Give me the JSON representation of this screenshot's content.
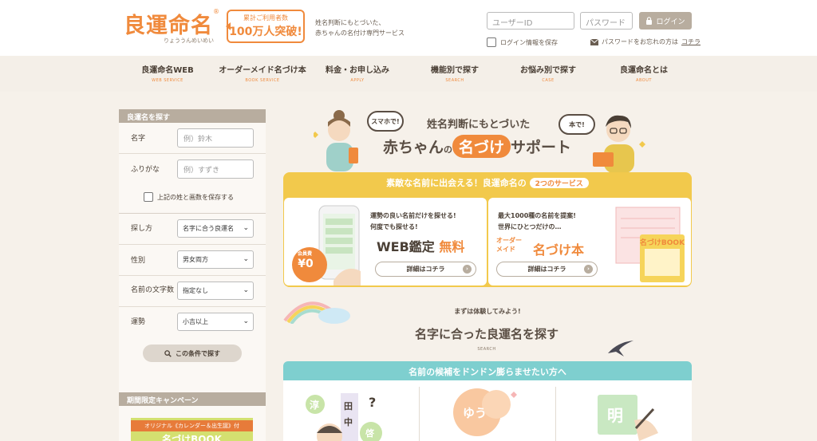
{
  "header": {
    "logo_text": "良運命名",
    "logo_mark": "®",
    "logo_sub": "りょううんめいめい",
    "badge_line1": "累計ご利用者数",
    "badge_line2": "100万人突破!",
    "tagline_line1": "姓名判断にもとづいた、",
    "tagline_line2": "赤ちゃんの名付け専門サービス",
    "user_id_placeholder": "ユーザーID",
    "password_placeholder": "パスワード",
    "login_label": "ログイン",
    "save_login_label": "ログイン情報を保存",
    "forgot_text": "パスワードをお忘れの方は",
    "forgot_link": "コチラ"
  },
  "nav": {
    "items": [
      {
        "jp": "良運命名WEB",
        "en": "WEB SERVICE"
      },
      {
        "jp": "オーダーメイド名づけ本",
        "en": "BOOK SERVICE"
      },
      {
        "jp": "料金・お申し込み",
        "en": "APPLY"
      },
      {
        "jp": "機能別で探す",
        "en": "SEARCH"
      },
      {
        "jp": "お悩み別で探す",
        "en": "CASE"
      },
      {
        "jp": "良運命名とは",
        "en": "ABOUT"
      }
    ]
  },
  "sidebar": {
    "heading": "良運名を探す",
    "name_label": "名字",
    "name_placeholder": "例）鈴木",
    "furigana_label": "ふりがな",
    "furigana_placeholder": "例）すずき",
    "save_label": "上記の姓と画数を保存する",
    "method_label": "探し方",
    "method_value": "名字に合う良運名",
    "gender_label": "性別",
    "gender_value": "男女両方",
    "length_label": "名前の文字数",
    "length_value": "指定なし",
    "fortune_label": "運勢",
    "fortune_value": "小吉以上",
    "search_button": "この条件で探す",
    "campaign_heading": "期間限定キャンペーン",
    "campaign_strip": "オリジナル《カレンダー＆出生誕》付",
    "campaign_big": "名づけBOOK"
  },
  "hero": {
    "bubble_left": "スマホで!",
    "bubble_right": "本で!",
    "line1": "姓名判断にもとづいた",
    "line2_a": "赤ちゃん",
    "line2_b": "の",
    "line2_hl": "名づけ",
    "line2_c": "サポート"
  },
  "services": {
    "title_a": "素敵な名前に出会える！良運命名の",
    "title_pill": "2つのサービス",
    "web_line1": "運勢の良い名前だけを探せる!",
    "web_line2": "何度でも探せる!",
    "web_big_a": "WEB鑑定",
    "web_big_b": "無料",
    "web_member": "会員費",
    "web_price": "¥0",
    "web_button": "詳細はコチラ",
    "book_line1": "最大1000種の名前を提案!",
    "book_line2": "世界にひとつだけの…",
    "book_small_a": "オーダー",
    "book_small_b": "メイド",
    "book_big": "名づけ本",
    "book_button": "詳細はコチラ",
    "book_cover": "名づけBOOK"
  },
  "search_section": {
    "try_caption": "まずは体験してみよう!",
    "title": "名字に合った良運名を探す",
    "sub": "SEARCH",
    "bar_text": "名前の候補をドンドン膨らませたい方へ",
    "col1_chars": [
      "淳",
      "田",
      "中",
      "?",
      "啓"
    ],
    "col2_text": "ゆう",
    "col3_text": "明"
  },
  "colors": {
    "accent": "#f08a3c",
    "yellow": "#f2c94c",
    "teal": "#7ecfcf",
    "beige": "#b8ad9f"
  }
}
